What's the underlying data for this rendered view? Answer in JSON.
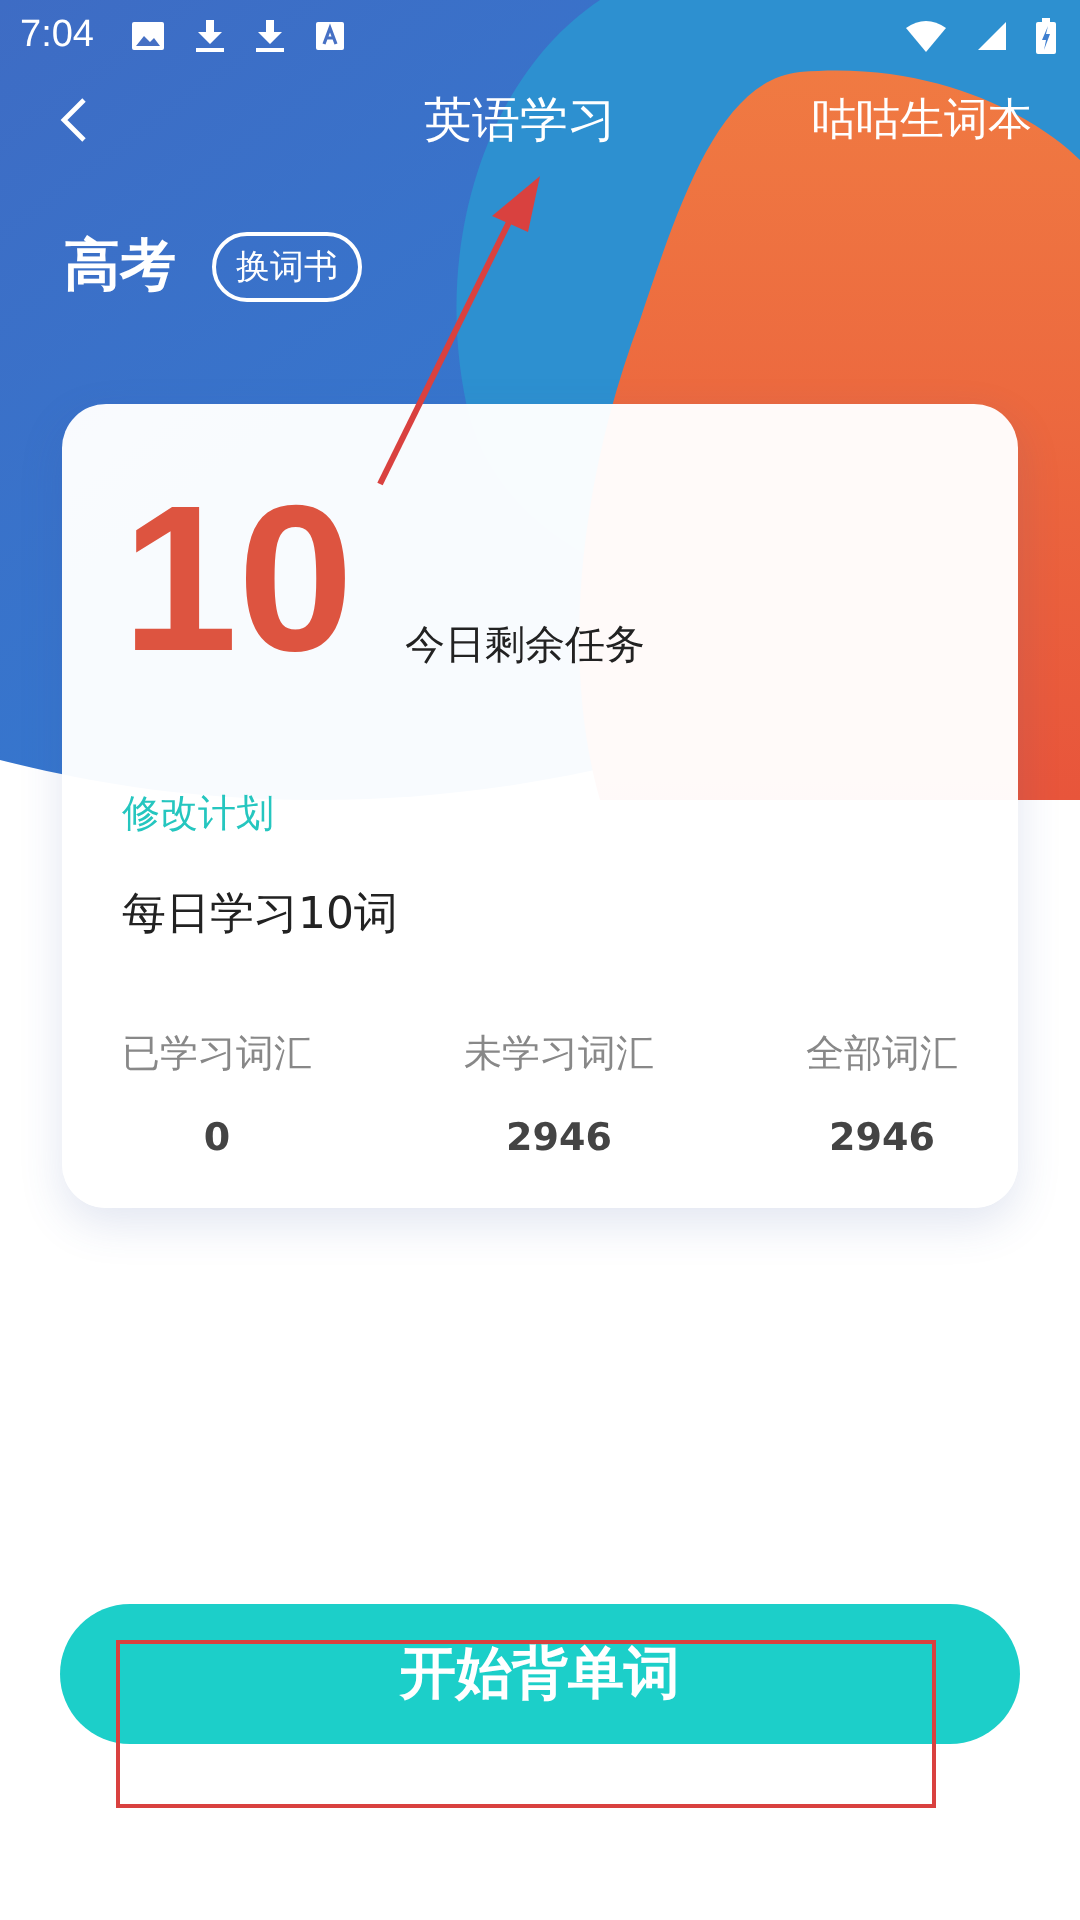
{
  "status_bar": {
    "time": "7:04"
  },
  "nav": {
    "title": "英语学习",
    "action": "咕咕生词本"
  },
  "book": {
    "name": "高考",
    "switch_button": "换词书"
  },
  "task": {
    "count": "10",
    "label": "今日剩余任务",
    "edit_link": "修改计划",
    "plan": "每日学习10词"
  },
  "stats": [
    {
      "label": "已学习词汇",
      "value": "0"
    },
    {
      "label": "未学习词汇",
      "value": "2946"
    },
    {
      "label": "全部词汇",
      "value": "2946"
    }
  ],
  "start_button": "开始背单词"
}
